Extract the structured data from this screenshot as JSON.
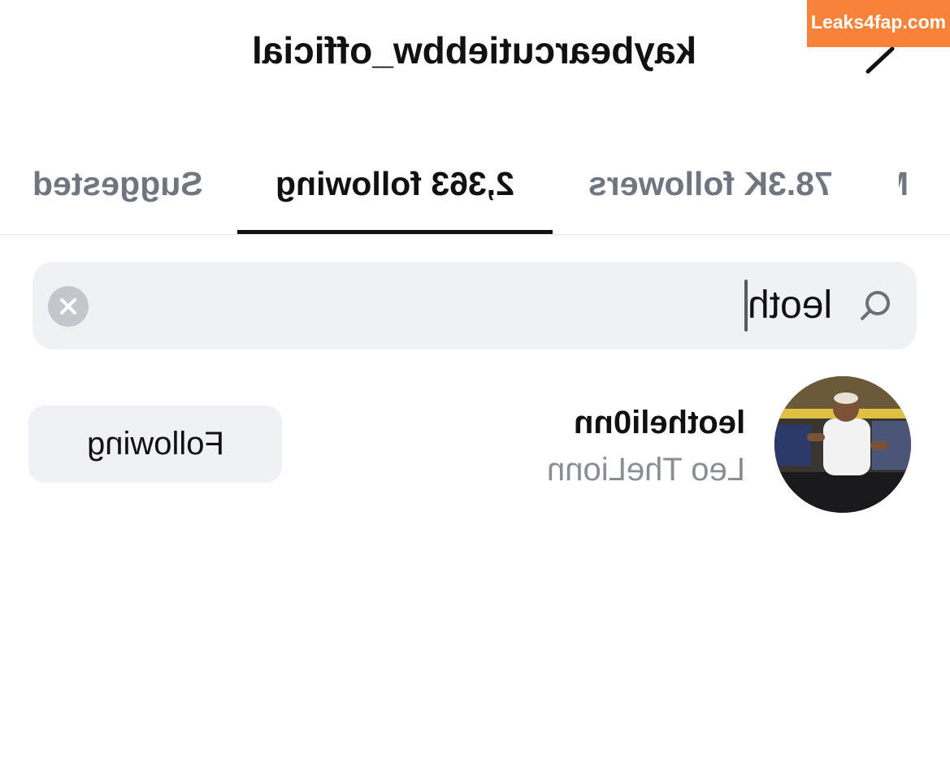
{
  "header": {
    "title": "kaybearcutiebbw_official",
    "edit_icon": "pencil-icon"
  },
  "watermark": {
    "text": "Leaks4fap.com",
    "color": "#f7823a"
  },
  "tabs": [
    {
      "label": "Suggested",
      "active": false
    },
    {
      "label": "2,363 following",
      "active": true
    },
    {
      "label": "78.3K followers",
      "active": false
    },
    {
      "label": "Mutual",
      "active": false
    }
  ],
  "search": {
    "value": "leoth",
    "icon": "search-icon",
    "clear_icon": "close-icon"
  },
  "results": [
    {
      "username": "leotheli0nn",
      "display_name": "Leo TheLionn",
      "button_label": "Following",
      "avatar": "avatar-photo"
    }
  ],
  "colors": {
    "text_primary": "#111111",
    "text_secondary": "#8a8d94",
    "tab_inactive": "#707680",
    "field_background": "#f0f1f4"
  }
}
